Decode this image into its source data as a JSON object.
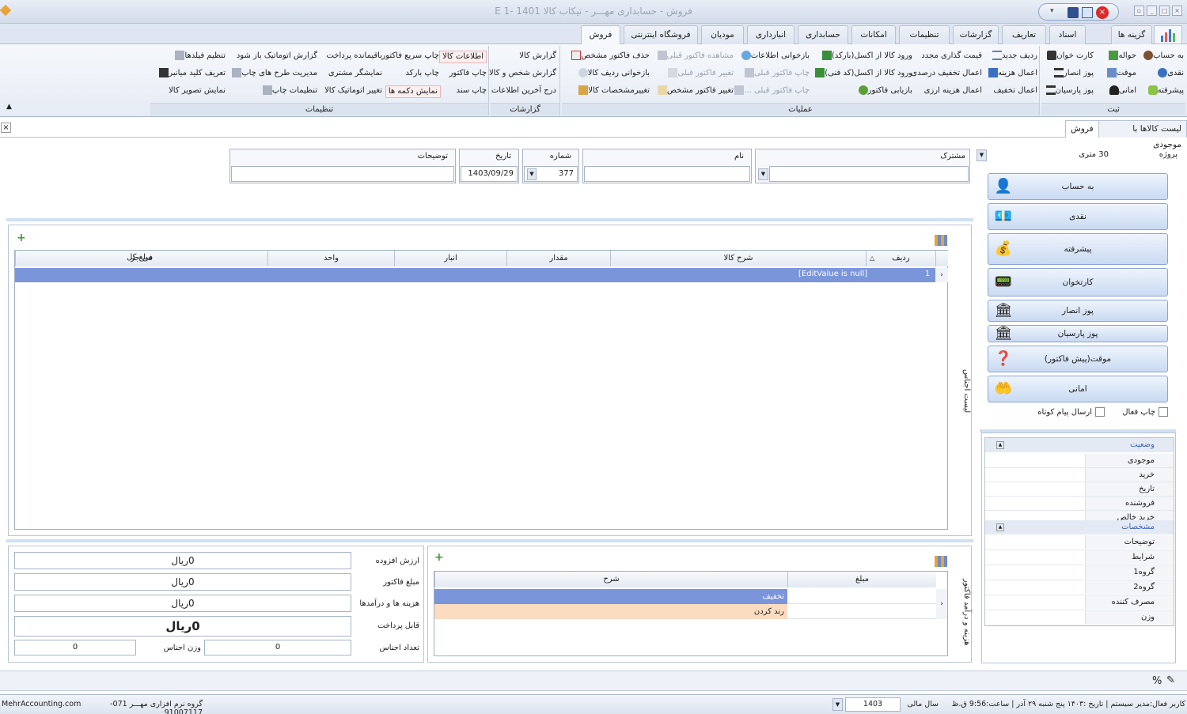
{
  "window": {
    "title": "فروش - حسابداری مهـــر - تیکاب کالا  1401 -1 E"
  },
  "tabs": [
    "گزینه ها",
    "اسناد",
    "تعاریف",
    "گزارشات",
    "تنظیمات",
    "امکانات",
    "حسابداری",
    "انبارداری",
    "مودیان",
    "فروشگاه اینترنتی",
    "فروش"
  ],
  "ribbon": {
    "sabt": {
      "label": "ثبت",
      "items": [
        "به حساب",
        "حواله",
        "کارت خوان",
        "نقدی",
        "موقت",
        "پوز انصار",
        "پیشرفته",
        "امانی",
        "پوز پارسیان"
      ]
    },
    "amaliat": {
      "label": "عملیات",
      "items": [
        "ردیف جدید",
        "قیمت گذاری مجدد",
        "ورود کالا از اکسل(بارکد)",
        "بازخوانی اطلاعات",
        "مشاهده فاکتور قبلی",
        "حذف فاکتور مشخص",
        "اعمال هزینه",
        "اعمال تخفیف درصدی",
        "ورود کالا از اکسل(کد فنی)",
        "چاپ فاکتور قبلی",
        "تغییر فاکتور قبلی",
        "بازخوانی ردیف کالا",
        "اعمال تخفیف",
        "اعمال هزینه ارزی",
        "بازیابی فاکتور",
        "چاپ فاکتور قبلی ...",
        "تغییر فاکتور مشخص",
        "تغییرمشخصات کالا"
      ]
    },
    "gozareshat": {
      "label": "گزارشات",
      "items": [
        "گزارش کالا",
        "گزارش شخص و کالا",
        "درج آخرین اطلاعات"
      ]
    },
    "tanzimat": {
      "label": "تنظیمات",
      "items": [
        "اطلاعات کالا",
        "چاپ سریع فاکتور",
        "باقیمانده پرداخت",
        "گزارش اتوماتیک باز شود",
        "تنظیم فیلدها",
        "چاپ فاکتور",
        "چاپ بارکد",
        "نمایشگر مشتری",
        "مدیریت طرح های چاپ",
        "تعریف کلید میانبر",
        "چاپ سند",
        "نمایش دکمه ها",
        "تغییر اتوماتیک کالا",
        "تنظیمات چاپ",
        "نمایش تصویر کالا"
      ]
    }
  },
  "subtabs": [
    "لیست کالاها با موجودی",
    "فروش"
  ],
  "project": {
    "label": "پروژه",
    "value": "30 متری"
  },
  "pay_buttons": [
    "به حساب",
    "نقدی",
    "پیشرفته",
    "کارتخوان",
    "پوز انصار",
    "پوز پارسیان",
    "موقت(پیش فاکتور)",
    "امانی"
  ],
  "options": {
    "print_active": "چاپ فعال",
    "send_sms": "ارسال پیام کوتاه"
  },
  "status_panel": {
    "header": "وضعیت",
    "rows": [
      "موجودی",
      "خرید",
      "تاریخ",
      "فروشنده",
      "خرید خالص"
    ]
  },
  "specs_panel": {
    "header": "مشخصات",
    "rows": [
      "توضیحات",
      "شرایط",
      "گروه1",
      "گروه2",
      "مصرف کننده",
      "وزن"
    ]
  },
  "form": {
    "customer_label": "مشترک",
    "name_label": "نام",
    "number_label": "شماره",
    "number_value": "377",
    "date_label": "تاریخ",
    "date_value": "1403/09/29",
    "desc_label": "توضیحات"
  },
  "items_grid": {
    "side_label": "لیست اجناس",
    "columns": [
      "ردیف",
      "شرح کالا",
      "مقدار",
      "انبار",
      "واحد",
      "فی جز",
      "مبلغ کل"
    ],
    "row": {
      "index": "1",
      "desc": "[EditValue is null]"
    }
  },
  "cost_grid": {
    "side_label": "هزینه و درآمد فاکتور",
    "columns": [
      "مبلغ",
      "شرح"
    ],
    "rows": [
      "تخفیف",
      "رند کردن"
    ]
  },
  "summary": {
    "vat_label": "ارزش افزوده",
    "vat": "0ریال",
    "invoice_label": "مبلغ فاکتور",
    "invoice": "0ریال",
    "costs_label": "هزینه ها و درآمدها",
    "costs": "0ریال",
    "payable_label": "قابل پرداخت",
    "payable": "0ریال",
    "count_label": "تعداد اجناس",
    "count": "0",
    "weight_label": "وزن اجناس",
    "weight": "0"
  },
  "statusbar": {
    "user": "کاربر فعال:مدیر سیستم  |  تاریخ :۱۴۰۳ پنج شنبه ۲۹ آذر  |  ساعت:9:56 ق.ظ",
    "fiscal_label": "سال مالی",
    "fiscal_value": "1403",
    "company": "گروه نرم افزاری مهـــر  071-91007117",
    "site": "MehrAccounting.com"
  },
  "percent_label": "%"
}
